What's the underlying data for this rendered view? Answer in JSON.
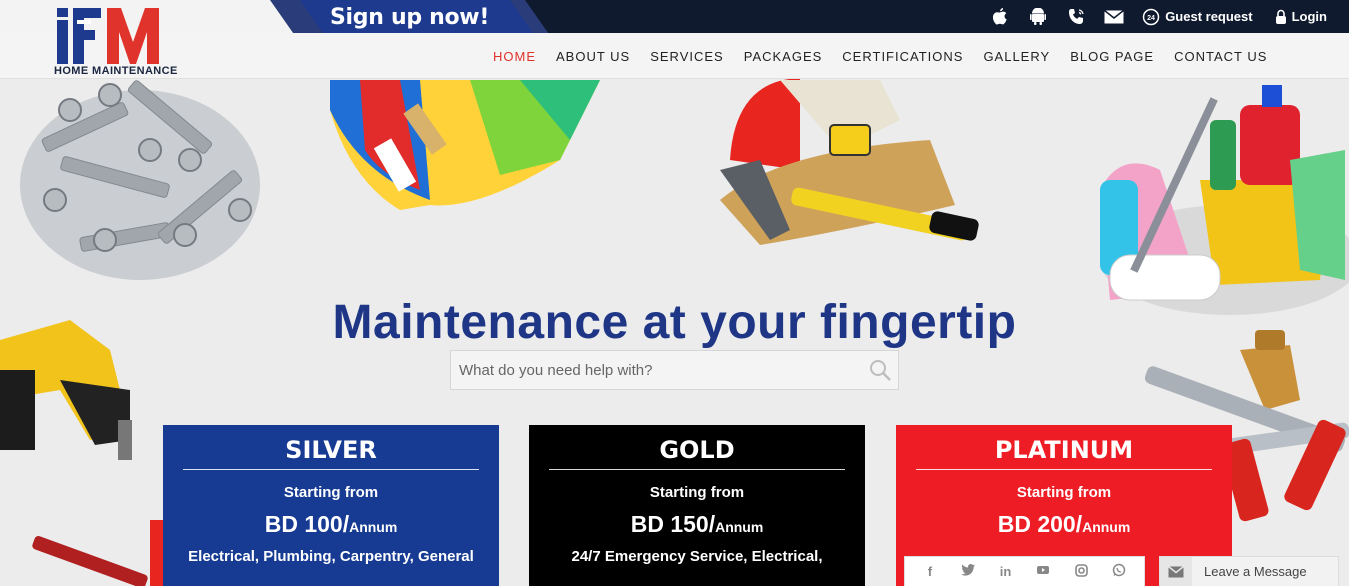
{
  "brand": {
    "logo_letters": "iFM",
    "caption": "HOME MAINTENANCE",
    "colors": {
      "navy": "#1d3a8f",
      "red": "#e0332b",
      "dark": "#0f1a2e"
    }
  },
  "topbar": {
    "signup_label": "Sign up now!",
    "icons": [
      "apple-icon",
      "android-icon",
      "phone-icon",
      "mail-icon"
    ],
    "guest_request_label": "Guest request",
    "login_label": "Login"
  },
  "nav": {
    "items": [
      {
        "label": "HOME",
        "active": true
      },
      {
        "label": "ABOUT US",
        "active": false
      },
      {
        "label": "SERVICES",
        "active": false
      },
      {
        "label": "PACKAGES",
        "active": false
      },
      {
        "label": "CERTIFICATIONS",
        "active": false
      },
      {
        "label": "GALLERY",
        "active": false
      },
      {
        "label": "BLOG PAGE",
        "active": false
      },
      {
        "label": "CONTACT US",
        "active": false
      }
    ]
  },
  "hero": {
    "title": "Maintenance at your fingertip",
    "search_placeholder": "What do you need help with?"
  },
  "packages": [
    {
      "name": "SILVER",
      "from_label": "Starting from",
      "price": "BD 100/",
      "period": "Annum",
      "desc": "Electrical, Plumbing, Carpentry, General",
      "color": "#173b93"
    },
    {
      "name": "GOLD",
      "from_label": "Starting from",
      "price": "BD 150/",
      "period": "Annum",
      "desc": "24/7 Emergency Service, Electrical,",
      "color": "#000000"
    },
    {
      "name": "PLATINUM",
      "from_label": "Starting from",
      "price": "BD 200/",
      "period": "Annum",
      "desc": "",
      "color": "#ee1c25"
    }
  ],
  "social": {
    "icons": [
      "facebook-icon",
      "twitter-icon",
      "linkedin-icon",
      "youtube-icon",
      "instagram-icon",
      "whatsapp-icon"
    ]
  },
  "chat": {
    "label": "Leave a Message"
  }
}
